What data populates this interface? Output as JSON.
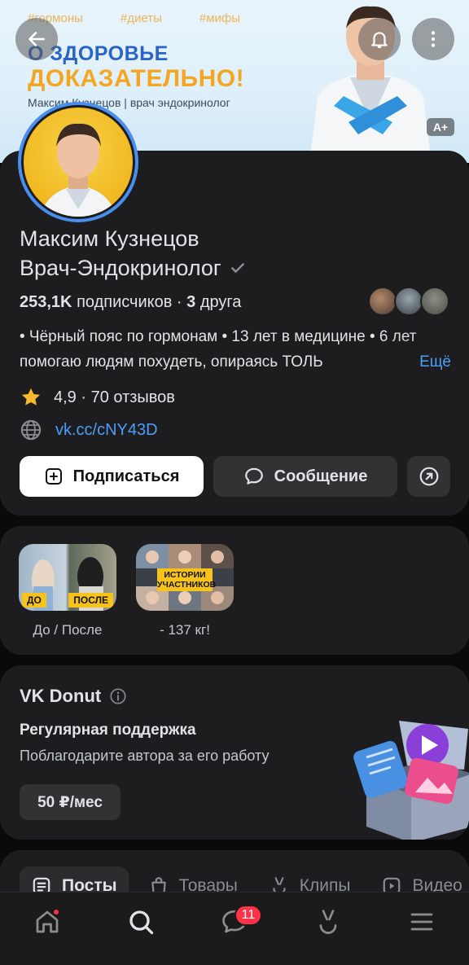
{
  "cover": {
    "tags": [
      "#гормоны",
      "#диеты",
      "#мифы"
    ],
    "headline_1": "О ЗДОРОВЬЕ",
    "headline_2": "ДОКАЗАТЕЛЬНО!",
    "subline": "Максим Кузнецов | врач эндокринолог",
    "font_scale_badge": "A+"
  },
  "top_buttons": {
    "back": "back-arrow-icon",
    "bell": "bell-icon",
    "menu": "more-vertical-icon"
  },
  "profile": {
    "name_line_1": "Максим Кузнецов",
    "name_line_2": "Врач-Эндокринолог",
    "subscribers_count": "253,1K",
    "subscribers_label": "подписчиков",
    "separator": "·",
    "friends_count": "3",
    "friends_label": "друга",
    "bio": "• Чёрный пояс по гормонам • 13 лет в медицине • 6 лет помогаю людям похудеть, опираясь ТОЛЬ",
    "bio_more": "Ещё",
    "rating": "4,9",
    "reviews": "· 70 отзывов",
    "link": "vk.cc/cNY43D"
  },
  "actions": {
    "subscribe": "Подписаться",
    "message": "Сообщение"
  },
  "highlights": [
    {
      "label": "До / После",
      "tag_left": "ДО",
      "tag_right": "ПОСЛЕ"
    },
    {
      "label": "- 137 кг!",
      "banner_1": "ИСТОРИИ",
      "banner_2": "УЧАСТНИКОВ"
    }
  ],
  "donut": {
    "title": "VK Donut",
    "heading": "Регулярная поддержка",
    "description": "Поблагодарите автора за его работу",
    "price": "50 ₽/мес"
  },
  "tabs": [
    {
      "label": "Посты",
      "icon": "posts-icon"
    },
    {
      "label": "Товары",
      "icon": "shop-bag-icon"
    },
    {
      "label": "Клипы",
      "icon": "clips-icon"
    },
    {
      "label": "Видео",
      "icon": "video-icon"
    }
  ],
  "bottom_nav": {
    "messages_badge": "11"
  },
  "colors": {
    "accent": "#4d9ef7",
    "badge": "#ff3347",
    "card": "#1d1d1f",
    "avatar_ring": "#4a8ff0"
  }
}
